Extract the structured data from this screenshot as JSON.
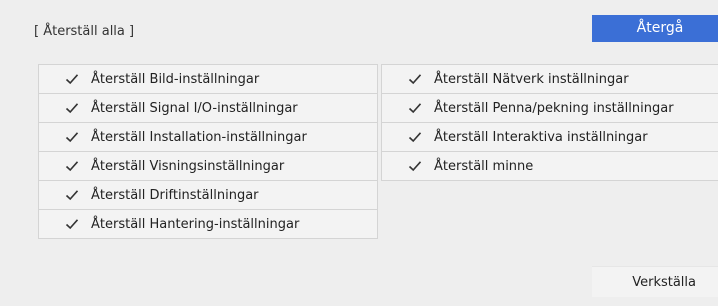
{
  "dialog": {
    "title": "[ Återställ alla ]",
    "back_label": "Återgå",
    "apply_label": "Verkställa"
  },
  "left_items": [
    {
      "label": "Återställ Bild-inställningar"
    },
    {
      "label": "Återställ Signal I/O-inställningar"
    },
    {
      "label": "Återställ Installation-inställningar"
    },
    {
      "label": "Återställ Visningsinställningar"
    },
    {
      "label": "Återställ Driftinställningar"
    },
    {
      "label": "Återställ Hantering-inställningar"
    }
  ],
  "right_items": [
    {
      "label": "Återställ Nätverk inställningar"
    },
    {
      "label": "Återställ Penna/pekning inställningar"
    },
    {
      "label": "Återställ Interaktiva inställningar"
    },
    {
      "label": "Återställ minne"
    }
  ],
  "icons": {
    "item": "checkmark-icon"
  }
}
